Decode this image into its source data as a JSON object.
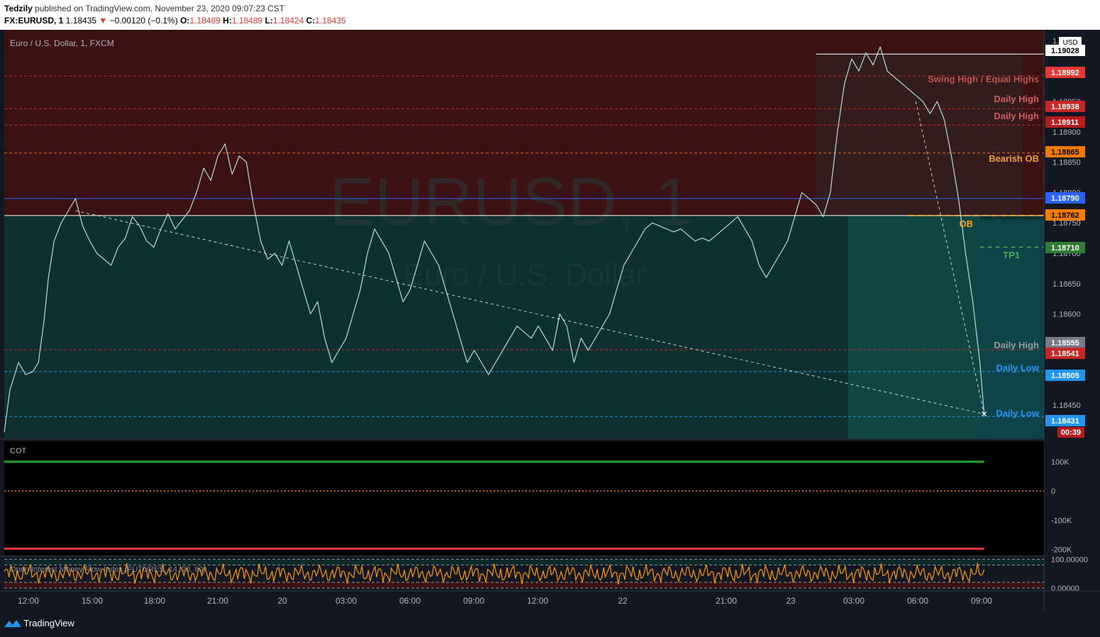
{
  "header": {
    "author": "Tedzily",
    "published_text": "published on TradingView.com, November 23, 2020 09:07:23 CST",
    "symbol": "FX:EURUSD, 1",
    "last": "1.18435",
    "change": "−0.00120 (−0.1%)",
    "o_label": "O:",
    "o_val": "1.18489",
    "h_label": "H:",
    "h_val": "1.18489",
    "l_label": "L:",
    "l_val": "1.18424",
    "c_label": "C:",
    "c_val": "1.18435"
  },
  "legend": "Euro / U.S. Dollar, 1, FXCM",
  "watermark": {
    "symbol": "EURUSD, 1",
    "name": "Euro / U.S. Dollar"
  },
  "currency_label": "USD",
  "footer_brand": "TradingView",
  "cot_label": "COT",
  "mfi_label": "Open Interest Money Flow Index (FUTURES, 14, 20, 80)",
  "chart_data": {
    "type": "line",
    "price_axis": {
      "min": 1.18395,
      "max": 1.19068
    },
    "price_ticks": [
      "1.19050",
      "1.19000",
      "1.18950",
      "1.18900",
      "1.18850",
      "1.18800",
      "1.18750",
      "1.18700",
      "1.18650",
      "1.18600",
      "1.18550",
      "1.18500",
      "1.18450"
    ],
    "time_ticks": [
      "12:00",
      "15:00",
      "18:00",
      "21:00",
      "20",
      "03:00",
      "06:00",
      "09:00",
      "12:00",
      "22",
      "21:00",
      "23",
      "03:00",
      "06:00",
      "09:00"
    ],
    "price_path": [
      [
        0,
        1.18405
      ],
      [
        0.8,
        1.18475
      ],
      [
        2,
        1.1852
      ],
      [
        3,
        1.185
      ],
      [
        4,
        1.18505
      ],
      [
        4.8,
        1.1852
      ],
      [
        5.6,
        1.1859
      ],
      [
        6.2,
        1.1866
      ],
      [
        7,
        1.1872
      ],
      [
        8,
        1.1875
      ],
      [
        9,
        1.1877
      ],
      [
        10,
        1.1879
      ],
      [
        11,
        1.18745
      ],
      [
        12,
        1.1872
      ],
      [
        13,
        1.187
      ],
      [
        14,
        1.1869
      ],
      [
        15,
        1.1868
      ],
      [
        16,
        1.1871
      ],
      [
        17,
        1.18725
      ],
      [
        18,
        1.1876
      ],
      [
        19,
        1.18745
      ],
      [
        20,
        1.1872
      ],
      [
        21,
        1.1871
      ],
      [
        22,
        1.1874
      ],
      [
        23,
        1.18765
      ],
      [
        24,
        1.1874
      ],
      [
        25,
        1.18755
      ],
      [
        26,
        1.1877
      ],
      [
        27,
        1.188
      ],
      [
        28,
        1.1884
      ],
      [
        29,
        1.1882
      ],
      [
        30,
        1.1886
      ],
      [
        31,
        1.1888
      ],
      [
        32,
        1.1883
      ],
      [
        33,
        1.1886
      ],
      [
        34,
        1.1885
      ],
      [
        35,
        1.1878
      ],
      [
        36,
        1.1872
      ],
      [
        37,
        1.1869
      ],
      [
        38,
        1.187
      ],
      [
        39,
        1.1868
      ],
      [
        40,
        1.1872
      ],
      [
        41,
        1.1868
      ],
      [
        42,
        1.1864
      ],
      [
        43,
        1.186
      ],
      [
        44,
        1.1862
      ],
      [
        45,
        1.1856
      ],
      [
        46,
        1.1852
      ],
      [
        47,
        1.1854
      ],
      [
        48,
        1.1856
      ],
      [
        49,
        1.186
      ],
      [
        50,
        1.1864
      ],
      [
        51,
        1.187
      ],
      [
        52,
        1.1874
      ],
      [
        53,
        1.1872
      ],
      [
        54,
        1.187
      ],
      [
        55,
        1.1866
      ],
      [
        56,
        1.1862
      ],
      [
        57,
        1.1864
      ],
      [
        58,
        1.1868
      ],
      [
        59,
        1.1872
      ],
      [
        60,
        1.187
      ],
      [
        61,
        1.1868
      ],
      [
        62,
        1.1864
      ],
      [
        63,
        1.186
      ],
      [
        64,
        1.1856
      ],
      [
        65,
        1.1852
      ],
      [
        66,
        1.1854
      ],
      [
        67,
        1.1852
      ],
      [
        68,
        1.185
      ],
      [
        69,
        1.1852
      ],
      [
        70,
        1.1854
      ],
      [
        71,
        1.1856
      ],
      [
        72,
        1.1858
      ],
      [
        73,
        1.1857
      ],
      [
        74,
        1.1856
      ],
      [
        75,
        1.1858
      ],
      [
        76,
        1.1856
      ],
      [
        77,
        1.1854
      ],
      [
        78,
        1.186
      ],
      [
        79,
        1.1858
      ],
      [
        80,
        1.1852
      ],
      [
        81,
        1.1856
      ],
      [
        82,
        1.1854
      ],
      [
        83,
        1.1856
      ],
      [
        84,
        1.1858
      ],
      [
        85,
        1.186
      ],
      [
        86,
        1.1864
      ],
      [
        87,
        1.1868
      ],
      [
        88,
        1.187
      ],
      [
        89,
        1.1872
      ],
      [
        90,
        1.1874
      ],
      [
        91,
        1.1875
      ],
      [
        92,
        1.18745
      ],
      [
        93,
        1.1874
      ],
      [
        94,
        1.18735
      ],
      [
        95,
        1.1874
      ],
      [
        96,
        1.1873
      ],
      [
        97,
        1.1872
      ],
      [
        98,
        1.18725
      ],
      [
        99,
        1.1872
      ],
      [
        100,
        1.1873
      ],
      [
        101,
        1.1874
      ],
      [
        102,
        1.1875
      ],
      [
        103,
        1.1876
      ],
      [
        104,
        1.1874
      ],
      [
        105,
        1.1872
      ],
      [
        106,
        1.1868
      ],
      [
        107,
        1.1866
      ],
      [
        108,
        1.1868
      ],
      [
        109,
        1.187
      ],
      [
        110,
        1.1872
      ],
      [
        111,
        1.1876
      ],
      [
        112,
        1.188
      ],
      [
        113,
        1.1879
      ],
      [
        114,
        1.1878
      ],
      [
        115,
        1.1876
      ],
      [
        116,
        1.188
      ],
      [
        117,
        1.189
      ],
      [
        118,
        1.1898
      ],
      [
        119,
        1.1902
      ],
      [
        120,
        1.19
      ],
      [
        121,
        1.1903
      ],
      [
        122,
        1.1901
      ],
      [
        123,
        1.1904
      ],
      [
        124,
        1.19
      ],
      [
        125,
        1.1899
      ],
      [
        126,
        1.1898
      ],
      [
        127,
        1.1897
      ],
      [
        128,
        1.1896
      ],
      [
        129,
        1.1895
      ],
      [
        130,
        1.1893
      ],
      [
        131,
        1.1895
      ],
      [
        132,
        1.1892
      ],
      [
        133,
        1.1886
      ],
      [
        134,
        1.1879
      ],
      [
        135,
        1.187
      ],
      [
        136,
        1.1862
      ],
      [
        137,
        1.1852
      ],
      [
        137.6,
        1.18435
      ]
    ],
    "price_x_range": [
      0,
      146
    ],
    "cot": {
      "axis": {
        "min": -220000,
        "max": 170000
      },
      "ticks": [
        "100K",
        "0",
        "-100K",
        "-200K"
      ],
      "upper": 100000,
      "lower": -197000,
      "dotted": 0
    },
    "mfi": {
      "axis": {
        "min": -5,
        "max": 106
      },
      "ticks": [
        "100.00000",
        "0.00000"
      ],
      "bands": [
        100,
        80,
        20,
        0
      ]
    }
  },
  "price_labels": [
    {
      "value": "1.19028",
      "bg": "#ffffff",
      "fg": "#000000"
    },
    {
      "value": "1.18992",
      "bg": "#e53935",
      "fg": "#ffffff"
    },
    {
      "value": "1.18938",
      "bg": "#c62828",
      "fg": "#ffffff"
    },
    {
      "value": "1.18911",
      "bg": "#b71c1c",
      "fg": "#ffffff"
    },
    {
      "value": "1.18865",
      "bg": "#f57c00",
      "fg": "#000000"
    },
    {
      "value": "1.18790",
      "bg": "#2962ff",
      "fg": "#ffffff"
    },
    {
      "value": "1.18762",
      "bg": "#f57c00",
      "fg": "#000000"
    },
    {
      "value": "1.18710",
      "bg": "#2e7d32",
      "fg": "#ffffff"
    },
    {
      "value": "1.18555",
      "bg": "#787b86",
      "fg": "#ffffff"
    },
    {
      "value": "1.18541",
      "bg": "#c62828",
      "fg": "#ffffff"
    },
    {
      "value": "1.18505",
      "bg": "#2196f3",
      "fg": "#ffffff"
    },
    {
      "value": "1.18431",
      "bg": "#2196f3",
      "fg": "#ffffff"
    }
  ],
  "countdown": "00:39",
  "annotations": [
    {
      "text": "Swing High / Equal Highs",
      "color": "#c0544b"
    },
    {
      "text": "Daily High",
      "color": "#d06060"
    },
    {
      "text": "Daily High",
      "color": "#d06060"
    },
    {
      "text": "Bearish OB",
      "color": "#f0a030"
    },
    {
      "text": "OB",
      "color": "#f5a623"
    },
    {
      "text": "TP1",
      "color": "#4caf50"
    },
    {
      "text": "Daily High",
      "color": "#9a9a9a"
    },
    {
      "text": "Daily Low",
      "color": "#2196f3"
    },
    {
      "text": "Daily Low",
      "color": "#2196f3"
    }
  ],
  "colors": {
    "bg": "#131722",
    "red_zone": "#3b1111",
    "green_zone": "#0d3a36",
    "price_line": "#b2dfdb",
    "axis_text": "#b2b5be",
    "cot_up": "#26a52a",
    "cot_down": "#e53935",
    "mfi": "#ff9800"
  }
}
